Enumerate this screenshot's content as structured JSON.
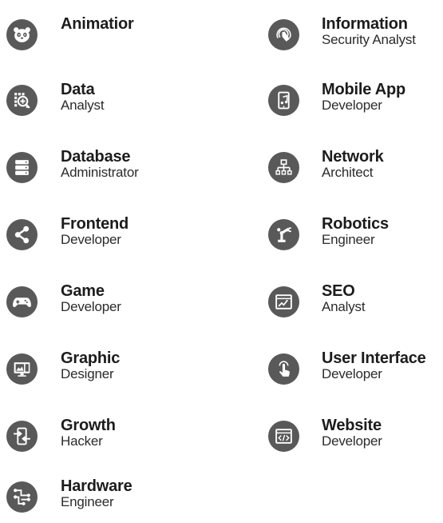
{
  "roles_left": [
    {
      "title": "Animatior",
      "subtitle": "",
      "icon": "panda-icon"
    },
    {
      "title": "Data",
      "subtitle": "Analyst",
      "icon": "data-analysis-icon"
    },
    {
      "title": "Database",
      "subtitle": "Administrator",
      "icon": "server-icon"
    },
    {
      "title": "Frontend",
      "subtitle": "Developer",
      "icon": "share-icon"
    },
    {
      "title": "Game",
      "subtitle": "Developer",
      "icon": "gamepad-icon"
    },
    {
      "title": "Graphic",
      "subtitle": "Designer",
      "icon": "monitor-image-icon"
    },
    {
      "title": "Growth",
      "subtitle": "Hacker",
      "icon": "phone-arrows-icon"
    },
    {
      "title": "Hardware",
      "subtitle": "Engineer",
      "icon": "circuit-icon"
    }
  ],
  "roles_right": [
    {
      "title": "Information",
      "subtitle": "Security Analyst",
      "icon": "fingerprint-touch-icon"
    },
    {
      "title": "Mobile App",
      "subtitle": "Developer",
      "icon": "mobile-music-icon"
    },
    {
      "title": "Network",
      "subtitle": "Architect",
      "icon": "network-icon"
    },
    {
      "title": "Robotics",
      "subtitle": "Engineer",
      "icon": "robot-arm-icon"
    },
    {
      "title": "SEO",
      "subtitle": "Analyst",
      "icon": "browser-chart-icon"
    },
    {
      "title": "User Interface",
      "subtitle": "Developer",
      "icon": "tap-hand-icon"
    },
    {
      "title": "Website",
      "subtitle": "Developer",
      "icon": "browser-code-icon"
    }
  ],
  "colors": {
    "icon_bg": "#595959",
    "icon_fg": "#ffffff",
    "text": "#222222"
  }
}
